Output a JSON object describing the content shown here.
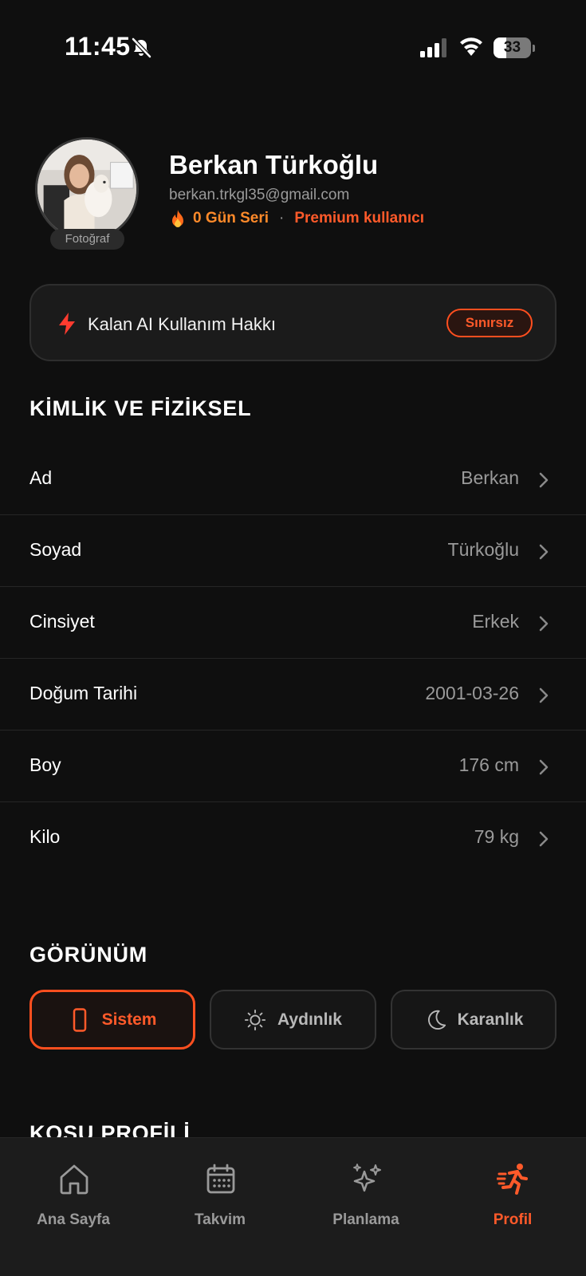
{
  "status_bar": {
    "time": "11:45",
    "battery": "33",
    "battery_level": 0.33,
    "icons": [
      "bell-slash-icon",
      "signal-icon",
      "wifi-icon",
      "battery-icon"
    ]
  },
  "profile": {
    "avatar_label": "Fotoğraf",
    "name": "Berkan Türkoğlu",
    "email": "berkan.trkgl35@gmail.com",
    "streak": "0 Gün Seri",
    "separator": "·",
    "membership": "Premium kullanıcı"
  },
  "ai_usage": {
    "label": "Kalan AI Kullanım Hakkı",
    "value": "Sınırsız",
    "icon": "bolt-icon"
  },
  "identity_section": {
    "title": "KİMLİK VE FİZİKSEL",
    "rows": [
      {
        "label": "Ad",
        "value": "Berkan"
      },
      {
        "label": "Soyad",
        "value": "Türkoğlu"
      },
      {
        "label": "Cinsiyet",
        "value": "Erkek"
      },
      {
        "label": "Doğum Tarihi",
        "value": "2001-03-26"
      },
      {
        "label": "Boy",
        "value": "176 cm"
      },
      {
        "label": "Kilo",
        "value": "79 kg"
      }
    ]
  },
  "appearance_section": {
    "title": "GÖRÜNÜM",
    "options": [
      {
        "label": "Sistem",
        "icon": "phone-icon",
        "selected": true
      },
      {
        "label": "Aydınlık",
        "icon": "sun-icon",
        "selected": false
      },
      {
        "label": "Karanlık",
        "icon": "moon-icon",
        "selected": false
      }
    ]
  },
  "running_section": {
    "title": "KOŞU PROFİLİ"
  },
  "tab_bar": {
    "tabs": [
      {
        "label": "Ana Sayfa",
        "icon": "home-icon",
        "active": false
      },
      {
        "label": "Takvim",
        "icon": "calendar-icon",
        "active": false
      },
      {
        "label": "Planlama",
        "icon": "sparkles-icon",
        "active": false
      },
      {
        "label": "Profil",
        "icon": "running-icon",
        "active": true
      }
    ]
  },
  "colors": {
    "background": "#0f0f0f",
    "accent": "#ff5a2a",
    "streak": "#ff8a2a",
    "muted_text": "#9a9a9a",
    "card": "#1b1b1b",
    "tab_bar": "#1c1c1c"
  }
}
